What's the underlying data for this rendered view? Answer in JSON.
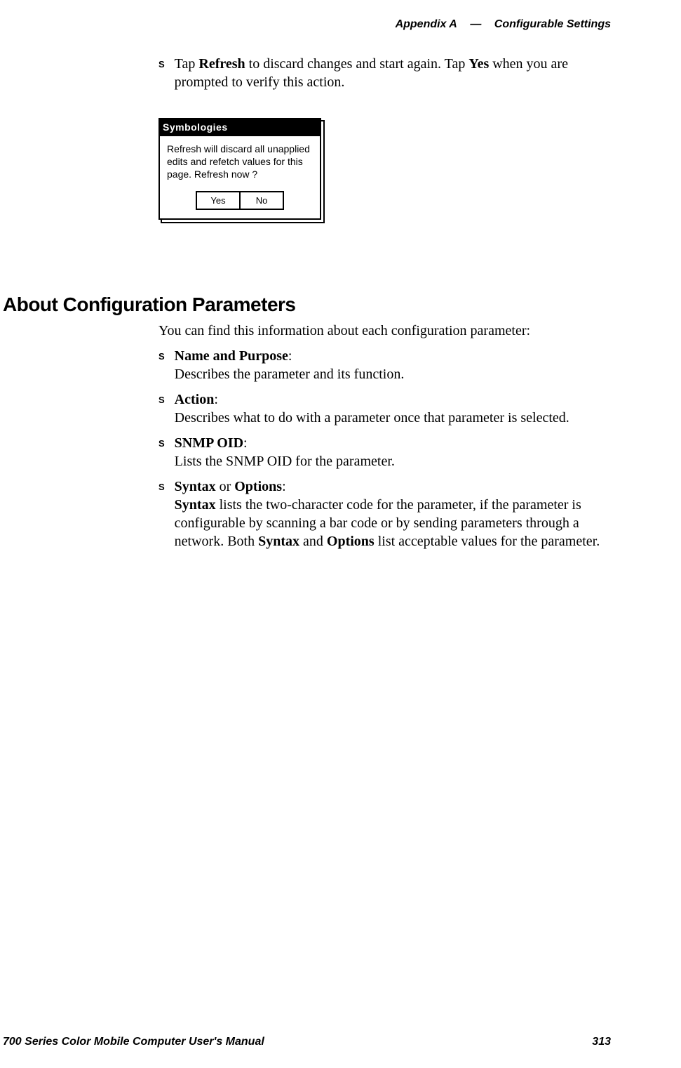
{
  "header": {
    "appendix": "Appendix A",
    "dash": "—",
    "section": "Configurable Settings"
  },
  "topBullet": {
    "pre": "Tap ",
    "bold1": "Refresh",
    "mid": " to discard changes and start again. Tap ",
    "bold2": "Yes",
    "post": " when you are prompted to verify this action."
  },
  "dialog": {
    "title": "Symbologies",
    "body": "Refresh will discard all unapplied edits and refetch values for this page. Refresh now ?",
    "yes": "Yes",
    "no": "No"
  },
  "sectionHeading": "About Configuration Parameters",
  "intro": "You can find this information about each configuration parameter:",
  "params": [
    {
      "titleBold": "Name and Purpose",
      "titlePost": ":",
      "desc": "Describes the parameter and its function."
    },
    {
      "titleBold": "Action",
      "titlePost": ":",
      "desc": "Describes what to do with a parameter once that parameter is selected."
    },
    {
      "titleBold": "SNMP OID",
      "titlePost": ":",
      "desc": "Lists the SNMP OID for the parameter."
    }
  ],
  "syntaxParam": {
    "bold1": "Syntax",
    "mid1": " or ",
    "bold2": "Options",
    "post1": ":",
    "line2pre": "",
    "bold3": "Syntax",
    "line2mid": " lists the two-character code for the parameter, if the parameter is configurable by scanning a bar code or by sending parameters through a network. Both ",
    "bold4": "Syntax",
    "line2mid2": " and ",
    "bold5": "Options",
    "line2post": " list acceptable values for the parameter."
  },
  "footer": {
    "left": "700 Series Color Mobile Computer User's Manual",
    "right": "313"
  }
}
